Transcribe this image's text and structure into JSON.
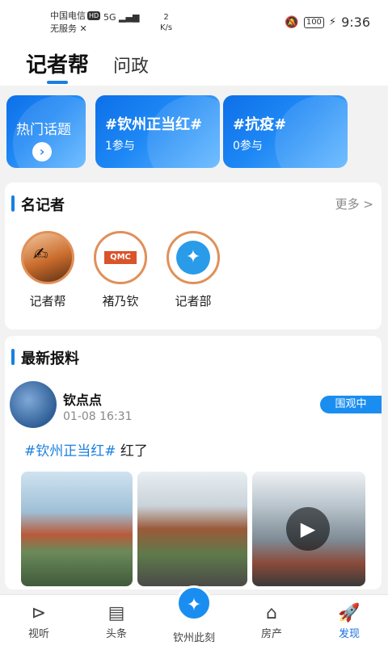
{
  "status_bar": {
    "carrier": "中国电信",
    "carrier_badge": "HD",
    "no_service": "无服务",
    "network": "5G",
    "speed_value": "2",
    "speed_unit": "K/s",
    "battery": "100",
    "time": "9:36"
  },
  "tabs": [
    {
      "label": "记者帮"
    },
    {
      "label": "问政"
    }
  ],
  "topics": {
    "hot": {
      "label": "热门话题",
      "arrow": "›"
    },
    "items": [
      {
        "title": "#钦州正当红#",
        "count": "1参与"
      },
      {
        "title": "#抗疫#",
        "count": "0参与"
      }
    ]
  },
  "reporters": {
    "title": "名记者",
    "more": "更多 >",
    "items": [
      {
        "name": "记者帮"
      },
      {
        "name": "褚乃钦"
      },
      {
        "name": "记者部"
      }
    ]
  },
  "news": {
    "title": "最新报料",
    "post": {
      "author": "钦点点",
      "time": "01-08 16:31",
      "badge": "围观中",
      "tag": "#钦州正当红#",
      "text": " 红了"
    }
  },
  "bottom_nav": [
    {
      "label": "视听",
      "icon": "play-circle-icon"
    },
    {
      "label": "头条",
      "icon": "document-icon"
    },
    {
      "label": "钦州此刻",
      "icon": "dolphin-logo-icon"
    },
    {
      "label": "房产",
      "icon": "house-icon"
    },
    {
      "label": "发现",
      "icon": "rocket-icon"
    }
  ],
  "colors": {
    "accent": "#1a7fe0",
    "badge": "#1a8ef0",
    "banner_start": "#0d6fe8",
    "banner_end": "#5fb6ff"
  }
}
